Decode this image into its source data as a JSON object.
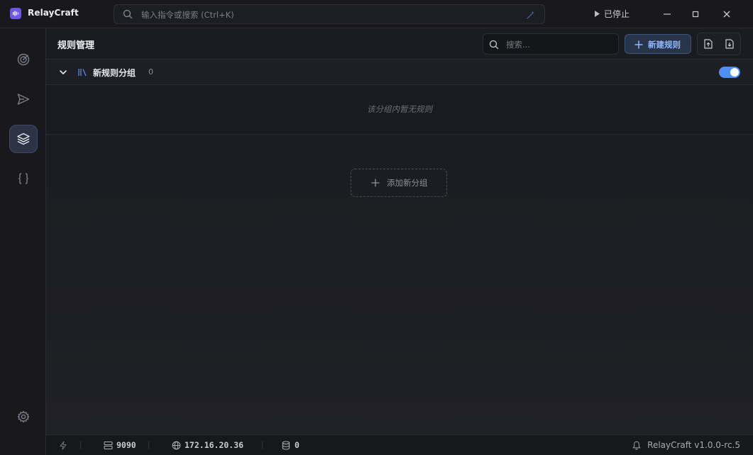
{
  "app": {
    "title": "RelayCraft"
  },
  "command_search": {
    "placeholder": "输入指令或搜索 (Ctrl+K)"
  },
  "proxy": {
    "status_label": "已停止"
  },
  "page": {
    "title": "规则管理"
  },
  "toolbar": {
    "search_placeholder": "搜索...",
    "new_rule_label": "新建规则"
  },
  "group": {
    "name": "新规则分组",
    "count": "0",
    "enabled": true,
    "empty_message": "该分组内暂无规则"
  },
  "add_group": {
    "label": "添加新分组"
  },
  "statusbar": {
    "port": "9090",
    "ip": "172.16.20.36",
    "connections": "0",
    "version": "RelayCraft v1.0.0-rc.5"
  },
  "colors": {
    "accent": "#4d8ff5",
    "brand": "#6f55e8",
    "primary_button_text": "#8fb6ff"
  },
  "icons": {
    "sidebar": [
      "radar-icon",
      "send-icon",
      "layers-icon",
      "braces-icon",
      "gear-icon"
    ],
    "statusbar": [
      "lightning-icon",
      "server-icon",
      "globe-icon",
      "database-icon",
      "bell-icon"
    ]
  }
}
